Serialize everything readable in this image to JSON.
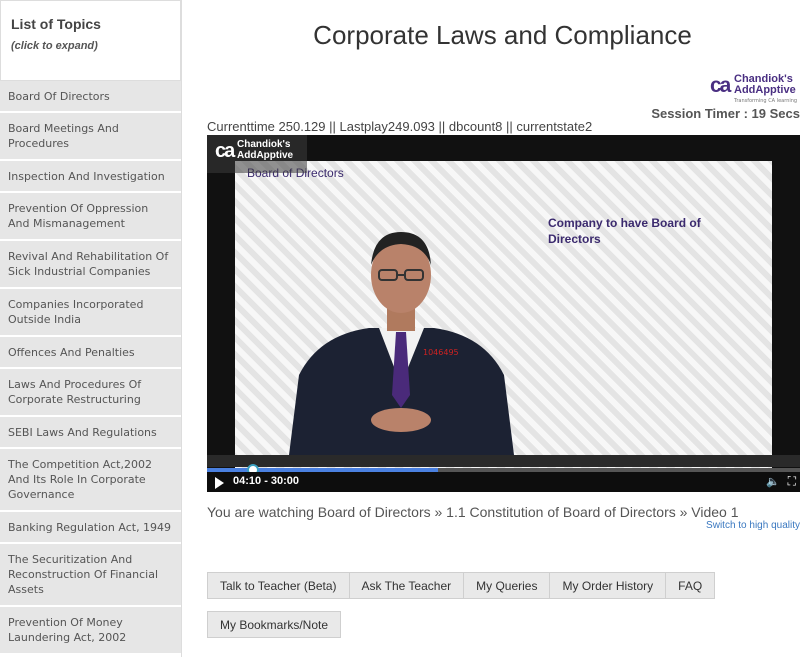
{
  "sidebar": {
    "title": "List of Topics",
    "subtitle": "(click to expand)",
    "topics": [
      "Board Of Directors",
      "Board Meetings And Procedures",
      "Inspection And Investigation",
      "Prevention Of Oppression And Mismanagement",
      "Revival And Rehabilitation Of Sick Industrial Companies",
      "Companies Incorporated Outside India",
      "Offences And Penalties",
      "Laws And Procedures Of Corporate Restructuring",
      "SEBI Laws And Regulations",
      "The Competition Act,2002 And Its Role In Corporate Governance",
      "Banking Regulation Act, 1949",
      "The Securitization And Reconstruction Of Financial Assets",
      "Prevention Of Money Laundering Act, 2002"
    ]
  },
  "page": {
    "title": "Corporate Laws and Compliance"
  },
  "brand": {
    "ca": "ca",
    "name_line1": "Chandiok's",
    "name_line2": "AddApptive",
    "tagline": "Transforming CA learning"
  },
  "session_timer": "Session Timer : 19 Secs",
  "debug_line": "Currenttime 250.129 || Lastplay249.093 || dbcount8 || currentstate2",
  "video": {
    "logo_ca": "ca",
    "logo_line1": "Chandiok's",
    "logo_line2": "AddApptive",
    "slide_heading": "Board of Directors",
    "slide_text": "Company to have Board of Directors",
    "watermark": "1046495",
    "time": "04:10 - 30:00",
    "progress": 0.39
  },
  "watching": "You are watching Board of Directors » 1.1 Constitution of Board of Directors » Video 1",
  "hq_link": "Switch to high quality",
  "tabs": [
    "Talk to Teacher (Beta)",
    "Ask The Teacher",
    "My Queries",
    "My Order History",
    "FAQ"
  ],
  "tab_bookmarks": "My Bookmarks/Note",
  "colors": {
    "brand_purple": "#4a2f82",
    "progress_blue": "#4a80e0",
    "link_blue": "#3a78c0",
    "sidebar_bg": "#e6e6e6"
  }
}
